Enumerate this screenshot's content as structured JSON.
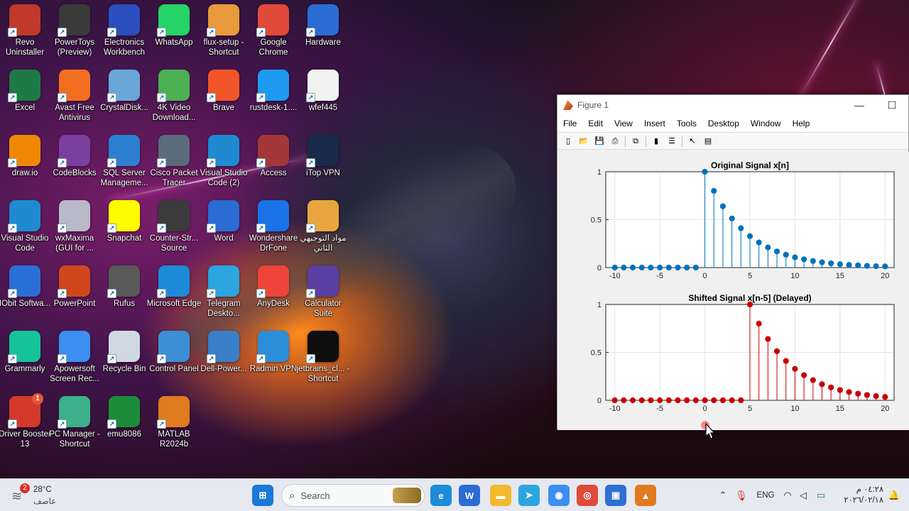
{
  "desktop": {
    "icons": [
      {
        "label": "Revo Uninstaller",
        "icon": "revo-uninstaller-icon",
        "color": "#c0392b"
      },
      {
        "label": "PowerToys (Preview)",
        "icon": "powertoys-icon",
        "color": "#3a3a3a"
      },
      {
        "label": "Electronics Workbench",
        "icon": "electronics-workbench-icon",
        "color": "#2b4fbf"
      },
      {
        "label": "WhatsApp",
        "icon": "whatsapp-icon",
        "color": "#25d366"
      },
      {
        "label": "flux-setup - Shortcut",
        "icon": "flux-icon",
        "color": "#e89a3c"
      },
      {
        "label": "Google Chrome",
        "icon": "chrome-icon",
        "color": "#e04a3a"
      },
      {
        "label": "Hardware",
        "icon": "word-doc-icon",
        "color": "#2b6cd4"
      },
      {
        "label": "Excel",
        "icon": "excel-icon",
        "color": "#1d7a45"
      },
      {
        "label": "Avast Free Antivirus",
        "icon": "avast-icon",
        "color": "#f26f21"
      },
      {
        "label": "CrystalDisk...",
        "icon": "crystaldisk-icon",
        "color": "#6aa7d8"
      },
      {
        "label": "4K Video Download...",
        "icon": "4k-video-downloader-icon",
        "color": "#4caf50"
      },
      {
        "label": "Brave",
        "icon": "brave-icon",
        "color": "#f1562b"
      },
      {
        "label": "rustdesk-1....",
        "icon": "rustdesk-icon",
        "color": "#1e9bf0"
      },
      {
        "label": "wfef445",
        "icon": "text-file-icon",
        "color": "#f2f2f2"
      },
      {
        "label": "draw.io",
        "icon": "drawio-icon",
        "color": "#f08705"
      },
      {
        "label": "CodeBlocks",
        "icon": "codeblocks-icon",
        "color": "#7b3fa0"
      },
      {
        "label": "SQL Server Manageme...",
        "icon": "sql-server-icon",
        "color": "#2d7fd0"
      },
      {
        "label": "Cisco Packet Tracer",
        "icon": "packet-tracer-icon",
        "color": "#5a6b7c"
      },
      {
        "label": "Visual Studio Code (2)",
        "icon": "vscode-icon",
        "color": "#1f8ad2"
      },
      {
        "label": "Access",
        "icon": "access-icon",
        "color": "#a4373a"
      },
      {
        "label": "iTop VPN",
        "icon": "itop-vpn-icon",
        "color": "#1a2a4a"
      },
      {
        "label": "Visual Studio Code",
        "icon": "vscode-icon",
        "color": "#1f8ad2"
      },
      {
        "label": "wxMaxima (GUI for ...",
        "icon": "wxmaxima-icon",
        "color": "#b9b9c9"
      },
      {
        "label": "Snapchat",
        "icon": "snapchat-icon",
        "color": "#fffc00"
      },
      {
        "label": "Counter-Str... Source",
        "icon": "counter-strike-icon",
        "color": "#3b3b3b"
      },
      {
        "label": "Word",
        "icon": "word-icon",
        "color": "#2b6cd4"
      },
      {
        "label": "Wondershare DrFone",
        "icon": "drfone-icon",
        "color": "#1a73e8"
      },
      {
        "label": "مواد التوجيهي الثاني",
        "icon": "folder-icon",
        "color": "#e9a640"
      },
      {
        "label": "IObit Softwa...",
        "icon": "iobit-icon",
        "color": "#2a6fd6"
      },
      {
        "label": "PowerPoint",
        "icon": "powerpoint-icon",
        "color": "#d0471e"
      },
      {
        "label": "Rufus",
        "icon": "rufus-icon",
        "color": "#5a5a5a"
      },
      {
        "label": "Microsoft Edge",
        "icon": "edge-icon",
        "color": "#1d8bd8"
      },
      {
        "label": "Telegram Deskto...",
        "icon": "telegram-icon",
        "color": "#2ca5e0"
      },
      {
        "label": "AnyDesk",
        "icon": "anydesk-icon",
        "color": "#ef443b"
      },
      {
        "label": "Calculator Suite",
        "icon": "calculator-suite-icon",
        "color": "#5b3fa3"
      },
      {
        "label": "Grammarly",
        "icon": "grammarly-icon",
        "color": "#15c39a"
      },
      {
        "label": "Apowersoft Screen Rec...",
        "icon": "apowersoft-icon",
        "color": "#3c8ef0"
      },
      {
        "label": "Recycle Bin",
        "icon": "recycle-bin-icon",
        "color": "#cfd8e3"
      },
      {
        "label": "Control Panel",
        "icon": "control-panel-icon",
        "color": "#3d8fd6"
      },
      {
        "label": "Dell-Power...",
        "icon": "dell-power-icon",
        "color": "#3a7fc9"
      },
      {
        "label": "Radmin VPN",
        "icon": "radmin-vpn-icon",
        "color": "#2b8ed8"
      },
      {
        "label": "jetbrains_cl... - Shortcut",
        "icon": "jetbrains-icon",
        "color": "#0e0e0e"
      },
      {
        "label": "Driver Booster 13",
        "icon": "driver-booster-icon",
        "color": "#d33a2c",
        "badge": "1"
      },
      {
        "label": "PC Manager - Shortcut",
        "icon": "pc-manager-icon",
        "color": "#3bb08a"
      },
      {
        "label": "emu8086",
        "icon": "emu8086-icon",
        "color": "#1d8c3a"
      },
      {
        "label": "MATLAB R2024b",
        "icon": "matlab-icon",
        "color": "#e07a1f"
      }
    ]
  },
  "figure": {
    "title": "Figure 1",
    "window_controls": {
      "minimize": "—",
      "maximize": "☐"
    },
    "menu": [
      "File",
      "Edit",
      "View",
      "Insert",
      "Tools",
      "Desktop",
      "Window",
      "Help"
    ],
    "toolbar_icons": [
      "new-figure-icon",
      "open-file-icon",
      "save-icon",
      "print-icon",
      "link-plot-icon",
      "insert-colorbar-icon",
      "insert-legend-icon",
      "pointer-icon",
      "property-inspector-icon"
    ]
  },
  "chart_data": [
    {
      "type": "stem",
      "title": "Original Signal x[n]",
      "color": "#0072bd",
      "x": [
        -10,
        -9,
        -8,
        -7,
        -6,
        -5,
        -4,
        -3,
        -2,
        -1,
        0,
        1,
        2,
        3,
        4,
        5,
        6,
        7,
        8,
        9,
        10,
        11,
        12,
        13,
        14,
        15,
        16,
        17,
        18,
        19,
        20
      ],
      "values": [
        0,
        0,
        0,
        0,
        0,
        0,
        0,
        0,
        0,
        0,
        1,
        0.8,
        0.64,
        0.512,
        0.41,
        0.328,
        0.262,
        0.21,
        0.168,
        0.134,
        0.107,
        0.086,
        0.069,
        0.055,
        0.044,
        0.035,
        0.028,
        0.023,
        0.018,
        0.014,
        0.012
      ],
      "xlim": [
        -11,
        21
      ],
      "ylim": [
        0,
        1
      ],
      "xticks": [
        "-10",
        "-5",
        "0",
        "5",
        "10",
        "15",
        "20"
      ],
      "yticks": [
        "0",
        "0.5",
        "1"
      ],
      "grid": true
    },
    {
      "type": "stem",
      "title": "Shifted Signal x[n-5] (Delayed)",
      "color": "#cc0000",
      "x": [
        -10,
        -9,
        -8,
        -7,
        -6,
        -5,
        -4,
        -3,
        -2,
        -1,
        0,
        1,
        2,
        3,
        4,
        5,
        6,
        7,
        8,
        9,
        10,
        11,
        12,
        13,
        14,
        15,
        16,
        17,
        18,
        19,
        20
      ],
      "values": [
        0,
        0,
        0,
        0,
        0,
        0,
        0,
        0,
        0,
        0,
        0,
        0,
        0,
        0,
        0,
        1,
        0.8,
        0.64,
        0.512,
        0.41,
        0.328,
        0.262,
        0.21,
        0.168,
        0.134,
        0.107,
        0.086,
        0.069,
        0.055,
        0.044,
        0.035
      ],
      "xlim": [
        -11,
        21
      ],
      "ylim": [
        0,
        1
      ],
      "xticks": [
        "-10",
        "-5",
        "0",
        "5",
        "10",
        "15",
        "20"
      ],
      "yticks": [
        "0",
        "0.5",
        "1"
      ],
      "grid": true
    }
  ],
  "taskbar": {
    "weather_temp": "28°C",
    "weather_desc": "عاصف",
    "weather_badge": "2",
    "search_placeholder": "Search",
    "apps": [
      {
        "name": "start-icon",
        "color": "#1a78d8",
        "glyph": "⊞"
      },
      {
        "name": "edge-icon",
        "color": "#1d8bd8",
        "glyph": "e"
      },
      {
        "name": "word-icon",
        "color": "#2b6cd4",
        "glyph": "W"
      },
      {
        "name": "file-explorer-icon",
        "color": "#f3b92d",
        "glyph": "▬"
      },
      {
        "name": "telegram-icon",
        "color": "#2ca5e0",
        "glyph": "➤"
      },
      {
        "name": "zoom-icon",
        "color": "#3c8ef0",
        "glyph": "◉"
      },
      {
        "name": "chrome-icon",
        "color": "#e04a3a",
        "glyph": "◎"
      },
      {
        "name": "microsoft-store-icon",
        "color": "#2f6fd1",
        "glyph": "▣"
      },
      {
        "name": "matlab-icon",
        "color": "#e07a1f",
        "glyph": "▲"
      }
    ],
    "language": "ENG",
    "time": "٠٤:٢٨ م",
    "date": "٢٠٢٦/٠٢/١٨"
  }
}
